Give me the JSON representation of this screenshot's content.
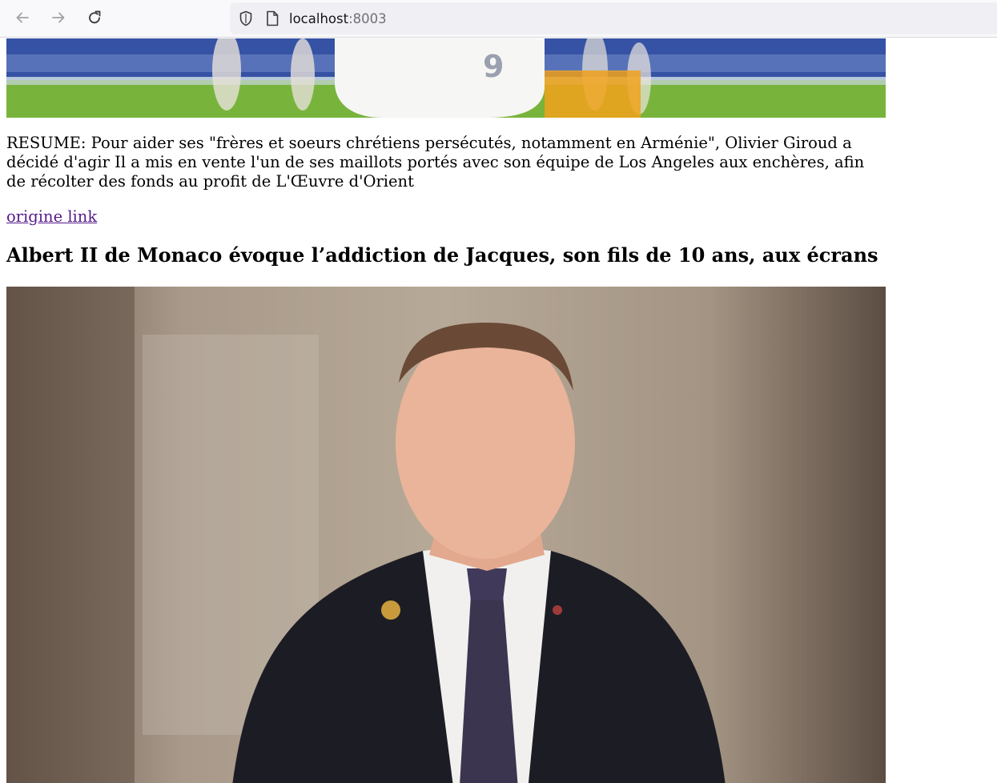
{
  "browser": {
    "url_host": "localhost",
    "url_port": ":8003",
    "icons": {
      "back": "arrow-left-icon",
      "forward": "arrow-right-icon",
      "reload": "reload-icon",
      "security": "shield-icon",
      "page": "page-icon"
    }
  },
  "article_1": {
    "image_alt": "Football player in white jersey number 9 on the pitch",
    "summary": "RESUME: Pour aider ses \"frères et soeurs chrétiens persécutés, notamment en Arménie\", Olivier Giroud a décidé d'agir Il a mis en vente l'un de ses maillots portés avec son équipe de Los Angeles aux enchères, afin de récolter des fonds au profit de L'Œuvre d'Orient",
    "link_label": "origine link"
  },
  "article_2": {
    "title": "Albert II de Monaco évoque l’addiction de Jacques, son fils de 10 ans, aux écrans",
    "image_alt": "Portrait of Albert II de Monaco in a dark suit and purple tie"
  }
}
